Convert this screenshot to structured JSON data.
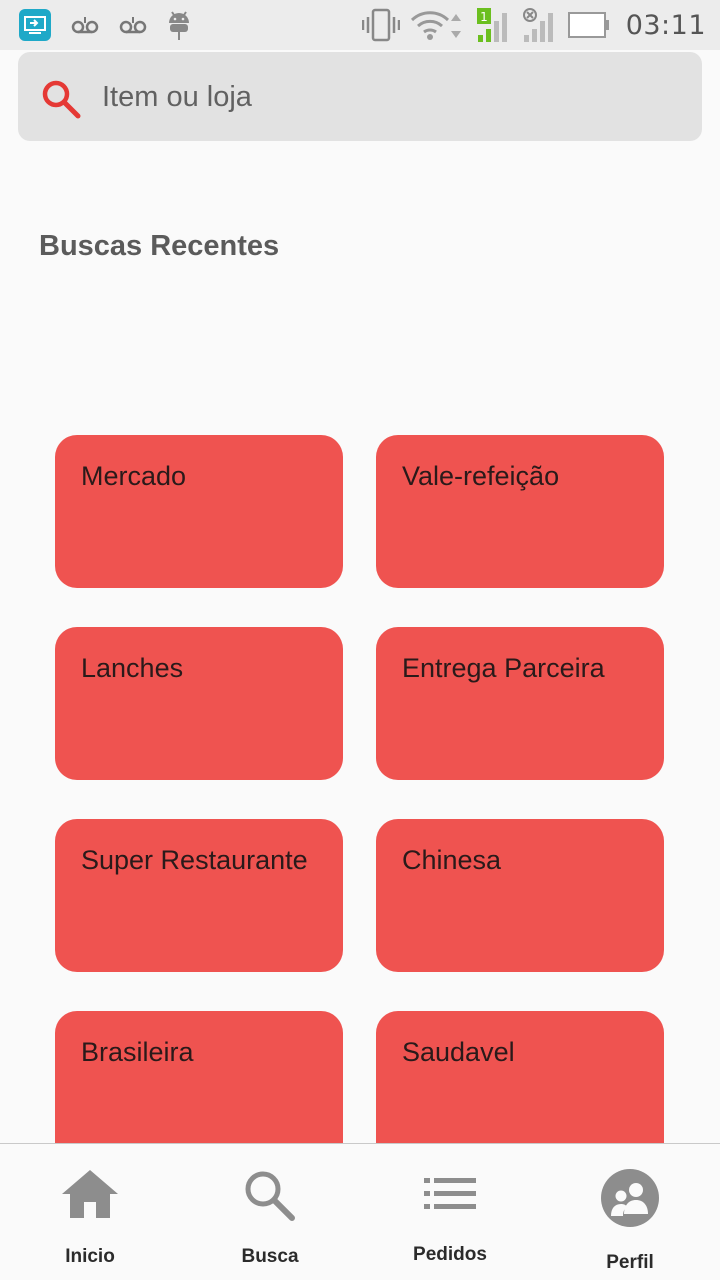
{
  "status_bar": {
    "time": "03:11",
    "icons": [
      "screen-cast-icon",
      "voicemail-icon",
      "voicemail-icon",
      "android-debug-icon",
      "vibrate-icon",
      "wifi-icon",
      "signal-sim1-icon",
      "signal-no-sim-icon",
      "battery-icon"
    ],
    "sim_badge": "1"
  },
  "search": {
    "placeholder": "Item ou loja",
    "value": ""
  },
  "recent": {
    "title": "Buscas Recentes"
  },
  "categories": [
    {
      "label": "Mercado"
    },
    {
      "label": "Vale-refeição"
    },
    {
      "label": "Lanches"
    },
    {
      "label": "Entrega Parceira"
    },
    {
      "label": "Super Restaurante"
    },
    {
      "label": "Chinesa"
    },
    {
      "label": "Brasileira"
    },
    {
      "label": "Saudavel"
    }
  ],
  "colors": {
    "card": "#ef5350",
    "accent_search_icon": "#e53935",
    "nav_icon": "#8d8d8d"
  },
  "bottom_nav": {
    "items": [
      {
        "label": "Inicio",
        "icon": "home-icon"
      },
      {
        "label": "Busca",
        "icon": "search-icon"
      },
      {
        "label": "Pedidos",
        "icon": "list-icon"
      },
      {
        "label": "Perfil",
        "icon": "profile-icon"
      }
    ]
  }
}
